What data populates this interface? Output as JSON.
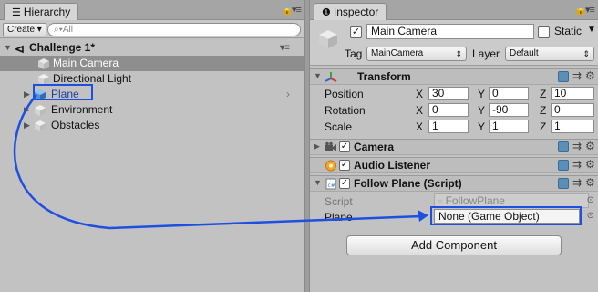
{
  "hierarchy": {
    "tab_label": "Hierarchy",
    "create_label": "Create",
    "search_placeholder": "All",
    "scene_name": "Challenge 1*",
    "items": [
      {
        "label": "Main Camera",
        "selected": true
      },
      {
        "label": "Directional Light",
        "selected": false
      },
      {
        "label": "Plane",
        "selected": false,
        "expandable": true
      },
      {
        "label": "Environment",
        "selected": false,
        "expandable": true
      },
      {
        "label": "Obstacles",
        "selected": false,
        "expandable": true
      }
    ]
  },
  "inspector": {
    "tab_label": "Inspector",
    "object_name": "Main Camera",
    "static_label": "Static",
    "tag_label": "Tag",
    "tag_value": "MainCamera",
    "layer_label": "Layer",
    "layer_value": "Default",
    "transform": {
      "title": "Transform",
      "position": {
        "label": "Position",
        "x": "30",
        "y": "0",
        "z": "10"
      },
      "rotation": {
        "label": "Rotation",
        "x": "0",
        "y": "-90",
        "z": "0"
      },
      "scale": {
        "label": "Scale",
        "x": "1",
        "y": "1",
        "z": "1"
      }
    },
    "axis_labels": {
      "x": "X",
      "y": "Y",
      "z": "Z"
    },
    "camera_title": "Camera",
    "audio_title": "Audio Listener",
    "script_component_title": "Follow Plane (Script)",
    "script_label": "Script",
    "script_value": "FollowPlane",
    "plane_label": "Plane",
    "plane_value": "None (Game Object)",
    "add_component_label": "Add Component"
  },
  "colors": {
    "highlight": "#1e50e0",
    "panel_bg": "#c2c2c2",
    "selection_bg": "#8e8e8e"
  }
}
